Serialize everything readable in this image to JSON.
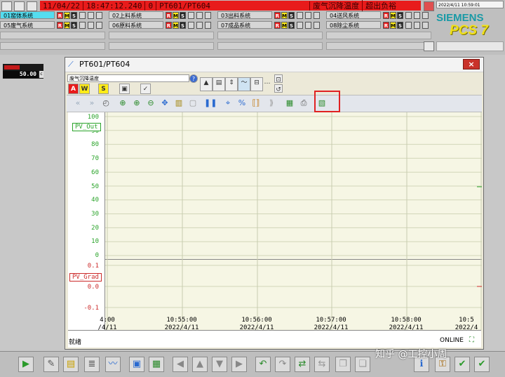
{
  "alarm": {
    "date": "11/04/22",
    "time": "18:47:12.240",
    "code": "0",
    "tag": "PT601/PT604",
    "message": "废气沉降温度",
    "status": "超出负裕"
  },
  "datetime": "2022/4/11 10:59:01",
  "logo": {
    "brand": "SIEMENS",
    "product": "PCS 7"
  },
  "areas": [
    {
      "label": "01窑体系统",
      "active": true
    },
    {
      "label": "02上料系统",
      "active": false
    },
    {
      "label": "03出料系统",
      "active": false
    },
    {
      "label": "04送风系统",
      "active": false
    },
    {
      "label": "05废气系统",
      "active": false
    },
    {
      "label": "06原料系统",
      "active": false
    },
    {
      "label": "07成品系统",
      "active": false
    },
    {
      "label": "08除尘系统",
      "active": false
    }
  ],
  "status_letters": {
    "r": "R",
    "m": "M",
    "s": "S"
  },
  "mini": {
    "value": "50.00",
    "unit": "c"
  },
  "window": {
    "title": "PT601/PT604",
    "tag_label": "废气沉降温度",
    "close": "×"
  },
  "toolbar_alarm_letters": {
    "a": "A",
    "w": "W",
    "s": "S"
  },
  "chart_data": [
    {
      "type": "line",
      "series": [
        {
          "name": "PV_Out",
          "values": []
        }
      ],
      "ylim": [
        0,
        100
      ],
      "yticks": [
        100,
        90,
        80,
        70,
        60,
        50,
        40,
        30,
        20,
        10,
        0
      ],
      "x": [
        "10:55:00",
        "10:56:00",
        "10:57:00",
        "10:58:00"
      ]
    },
    {
      "type": "line",
      "series": [
        {
          "name": "PV_Grad",
          "values": []
        }
      ],
      "ylim": [
        -0.1,
        0.1
      ],
      "yticks": [
        0.1,
        0.0,
        -0.1
      ]
    }
  ],
  "yticks_top": [
    "100",
    "90",
    "80",
    "70",
    "60",
    "50",
    "40",
    "30",
    "20",
    "10",
    "0"
  ],
  "yticks_bottom": [
    "0.1",
    "0.0",
    "-0.1"
  ],
  "series_labels": {
    "out": "PV_Out",
    "grad": "PV_Grad"
  },
  "xaxis": [
    {
      "time": "4:00",
      "date": "/4/11"
    },
    {
      "time": "10:55:00",
      "date": "2022/4/11"
    },
    {
      "time": "10:56:00",
      "date": "2022/4/11"
    },
    {
      "time": "10:57:00",
      "date": "2022/4/11"
    },
    {
      "time": "10:58:00",
      "date": "2022/4/11"
    },
    {
      "time": "10:5",
      "date": "2022/4"
    }
  ],
  "status": {
    "left": "就绪",
    "right": "ONLINE"
  },
  "watermark": "知乎 @工控小周"
}
